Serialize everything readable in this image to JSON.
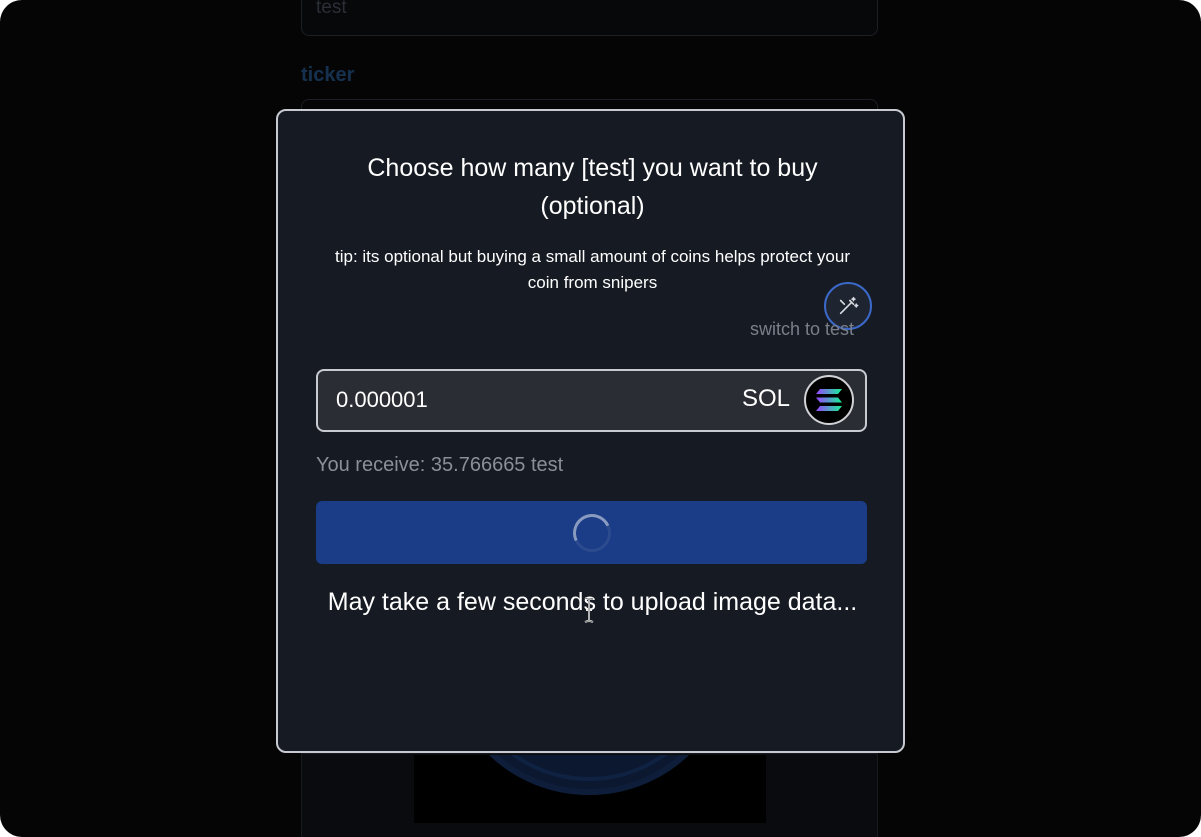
{
  "background_form": {
    "name_value": "test",
    "ticker_label": "ticker"
  },
  "modal": {
    "title": "Choose how many [test] you want to buy (optional)",
    "tip": "tip: its optional but buying a small amount of coins helps protect your coin from snipers",
    "switch_link": "switch to test",
    "amount_value": "0.000001",
    "currency": "SOL",
    "currency_icon": "solana-logo-icon",
    "receive_text": "You receive: 35.766665 test",
    "upload_note": "May take a few seconds to upload image data...",
    "accent_color": "#1b3c86",
    "magic_icon": "magic-wand-icon"
  }
}
